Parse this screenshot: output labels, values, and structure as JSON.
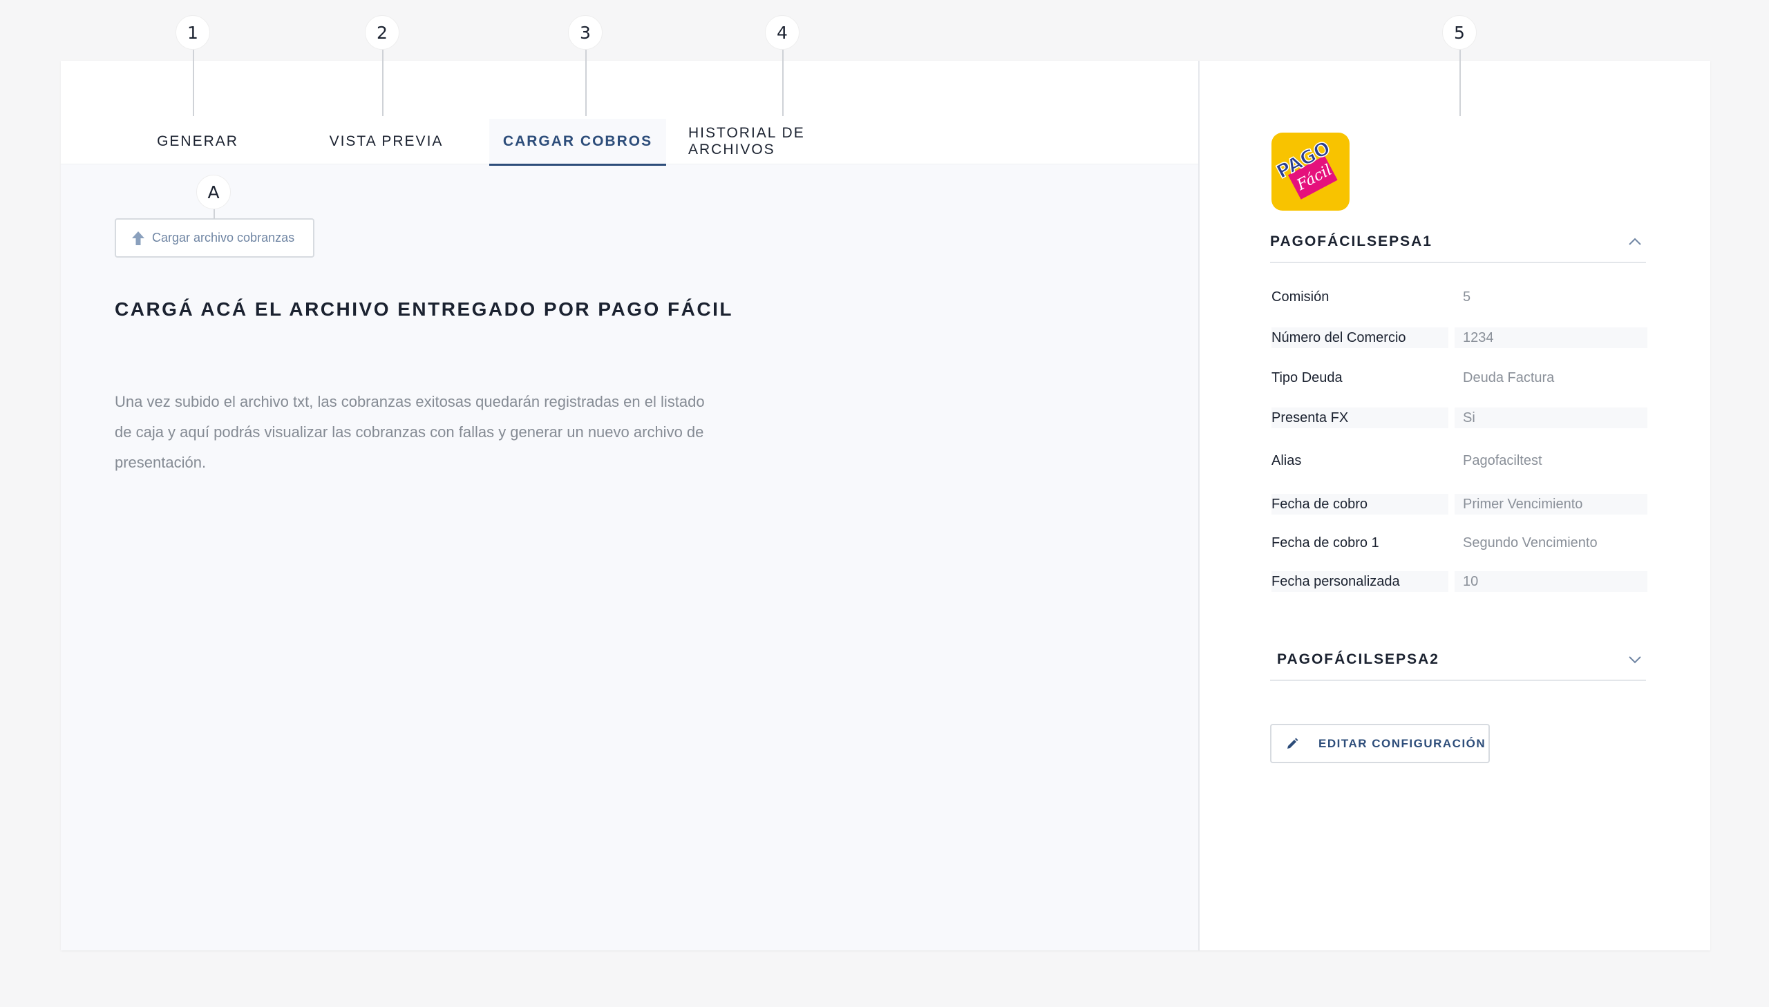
{
  "markers": {
    "m1": "1",
    "m2": "2",
    "m3": "3",
    "m4": "4",
    "m5": "5",
    "mA": "A"
  },
  "tabs": [
    {
      "label": "GENERAR",
      "active": false
    },
    {
      "label": "VISTA PREVIA",
      "active": false
    },
    {
      "label": "CARGAR COBROS",
      "active": true
    },
    {
      "label": "HISTORIAL DE ARCHIVOS",
      "active": false
    }
  ],
  "upload": {
    "label": "Cargar archivo cobranzas",
    "icon": "upload-arrow-icon"
  },
  "instructions": {
    "title": "CARGÁ ACÁ EL ARCHIVO ENTREGADO POR PAGO FÁCIL",
    "body": "Una vez subido el archivo txt, las cobranzas exitosas quedarán registradas en el listado de caja y aquí podrás visualizar las cobranzas con fallas y generar un nuevo archivo de presentación."
  },
  "side": {
    "logo": {
      "line1": "PAGO",
      "line2": "Fácil",
      "background": "#f8c300",
      "accent": "#e5117c"
    },
    "sections": [
      {
        "label": "PAGOFÁCILSEPSA1",
        "expanded": true,
        "rows": [
          {
            "key": "Comisión",
            "value": "5"
          },
          {
            "key": "Número del Comercio",
            "value": "1234"
          },
          {
            "key": "Tipo Deuda",
            "value": "Deuda Factura"
          },
          {
            "key": "Presenta FX",
            "value": "Si"
          },
          {
            "key": "Alias",
            "value": "Pagofaciltest"
          },
          {
            "key": "Fecha de cobro",
            "value": "Primer Vencimiento"
          },
          {
            "key": "Fecha de cobro 1",
            "value": "Segundo Vencimiento"
          },
          {
            "key": "Fecha personalizada",
            "value": "10"
          }
        ]
      },
      {
        "label": "PAGOFÁCILSEPSA2",
        "expanded": false,
        "rows": []
      }
    ],
    "edit_label": "EDITAR CONFIGURACIÓN"
  },
  "colors": {
    "accent": "#2d4d7a",
    "muted_text": "#858b94",
    "background": "#f6f6f7"
  }
}
